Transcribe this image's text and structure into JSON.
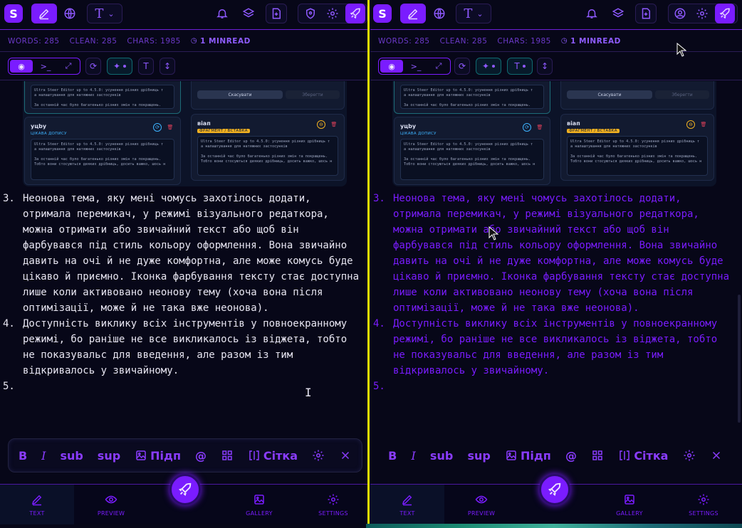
{
  "app": {
    "logo_letter": "S"
  },
  "stats": {
    "words": "WORDS: 285",
    "clean": "CLEAN: 285",
    "chars": "CHARS: 1985",
    "read": "1 MINREAD"
  },
  "toolbar2": {
    "seg_icons": [
      "eye-icon",
      "terminal-icon",
      "expand-icon"
    ]
  },
  "screenshot": {
    "cancel_label": "Скасувати",
    "save_label": "Зберегти",
    "card1": {
      "name": "yцbу",
      "tag": "ЦІКАВА ДОПИСУ"
    },
    "card2": {
      "name": "віап",
      "tag": "ФРАГМЕНТ / ВСТАВКА"
    },
    "editor_line1": "Ultra Steer Editor up to 4.5.0: усунення різних дрібниць т",
    "editor_line2": "а налаштування для натяжних застосунків",
    "editor_line3": "За останній час було багатенько різних змін та покращень.",
    "editor_line4": "Тобто вони стосуються деяких дрібниць, досить важко, шось н"
  },
  "list": [
    {
      "num": "3.",
      "text": "Неонова тема, яку мені чомусь захотілось додати, отримала перемикач, у режимі візуального редаткора, можна отримати або звичайний текст або щоб він фарбувався під стиль кольору оформлення. Вона звичайно давить на очі й не дуже комфортна, але може комусь буде цікаво й приємно. Іконка фарбування тексту стає доступна лише коли активовано неонову тему (хоча вона після оптимізації, може й не така вже неонова)."
    },
    {
      "num": "4.",
      "text": "Доступність виклику всіх інструментів у повноекранному режимі, бо раніше не все викликалось із віджета, тобто не показувальс для введення, але разом із тим відкривалось у звичайному."
    },
    {
      "num": "5.",
      "text": ""
    }
  ],
  "format": {
    "bold": "B",
    "italic": "I",
    "sub": "sub",
    "sup": "sup",
    "image_label": "Підп",
    "at": "@",
    "grid_label": "Сітка"
  },
  "nav": {
    "text": "TEXT",
    "preview": "PREVIEW",
    "gallery": "GALLERY",
    "settings": "SETTINGS"
  },
  "colors": {
    "accent": "#7a1cff",
    "divider": "#e8e300",
    "bg": "#070718"
  }
}
